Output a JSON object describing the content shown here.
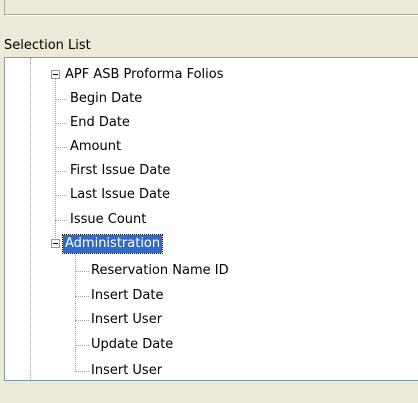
{
  "panel": {
    "title": "Selection List"
  },
  "tree": {
    "root": {
      "label": "APF  ASB Proforma Folios",
      "expanded": true,
      "children": [
        "Begin Date",
        "End Date",
        "Amount",
        "First Issue Date",
        "Last Issue Date",
        "Issue Count"
      ]
    },
    "group": {
      "label": "Administration",
      "expanded": true,
      "selected": true,
      "children": [
        "Reservation Name ID",
        "Insert Date",
        "Insert User",
        "Update Date",
        "Insert User"
      ]
    }
  },
  "colors": {
    "selection": "#316ac5",
    "window": "#ece9d8"
  }
}
